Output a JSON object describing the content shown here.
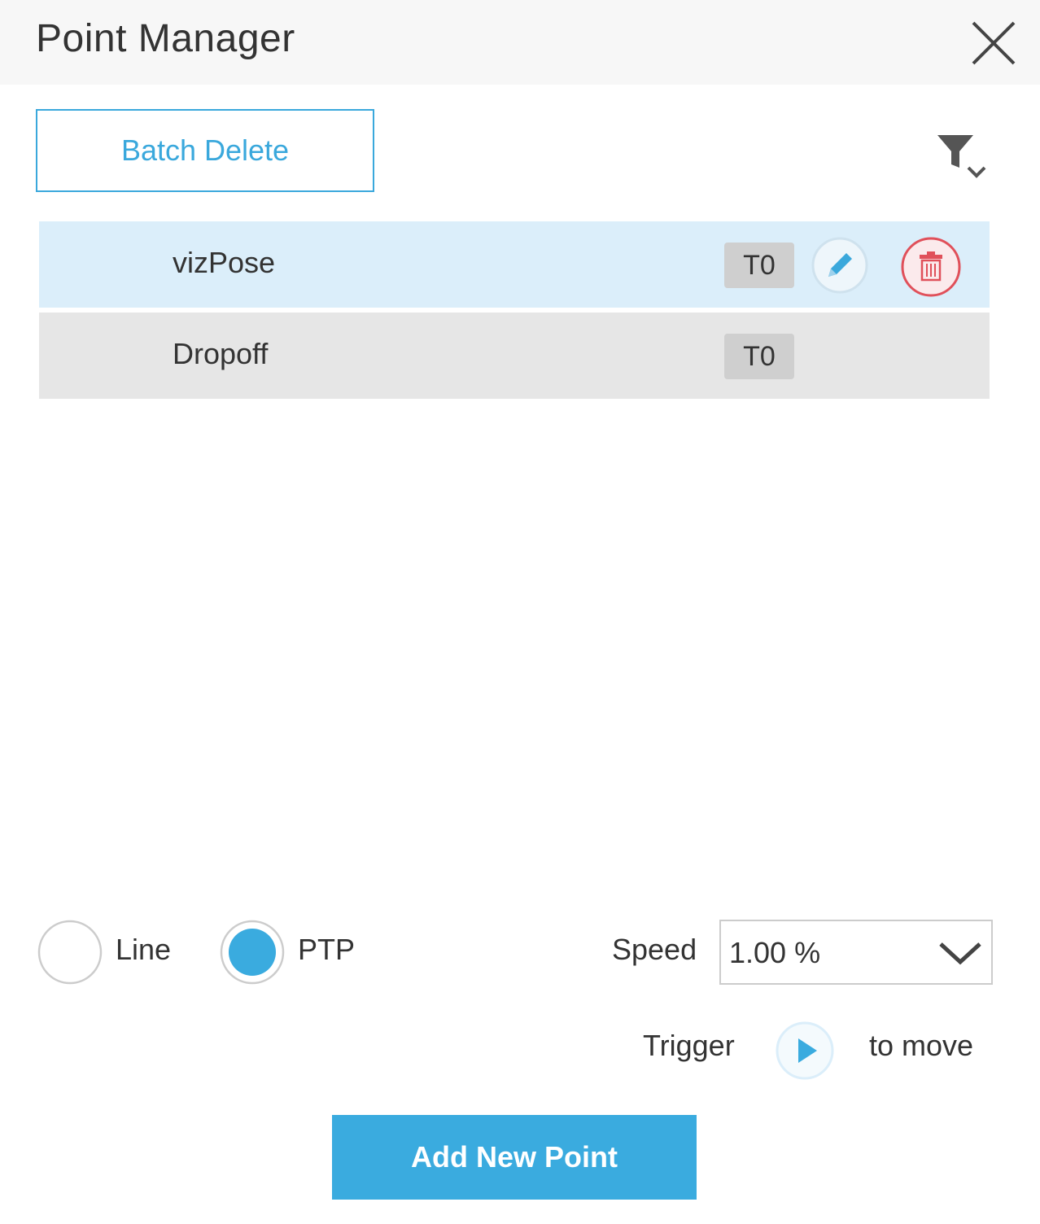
{
  "header": {
    "title": "Point Manager"
  },
  "toolbar": {
    "batch_delete_label": "Batch Delete"
  },
  "points": [
    {
      "name": "vizPose",
      "tool": "T0",
      "selected": true
    },
    {
      "name": "Dropoff",
      "tool": "T0",
      "selected": false
    }
  ],
  "motion": {
    "options": [
      {
        "label": "Line",
        "checked": false
      },
      {
        "label": "PTP",
        "checked": true
      }
    ],
    "speed_label": "Speed",
    "speed_value": "1.00 %"
  },
  "trigger": {
    "prefix": "Trigger",
    "suffix": "to move"
  },
  "actions": {
    "add_label": "Add New Point"
  },
  "icons": {
    "close": "close-icon",
    "filter": "filter-icon",
    "edit": "pencil-icon",
    "delete": "trash-icon",
    "play": "play-icon",
    "dropdown": "chevron-down-icon"
  },
  "colors": {
    "accent": "#3aa8dc",
    "selected_row": "#dbeefa",
    "row": "#e6e6e6",
    "danger": "#e0505a",
    "tag": "#cfcfcf"
  }
}
